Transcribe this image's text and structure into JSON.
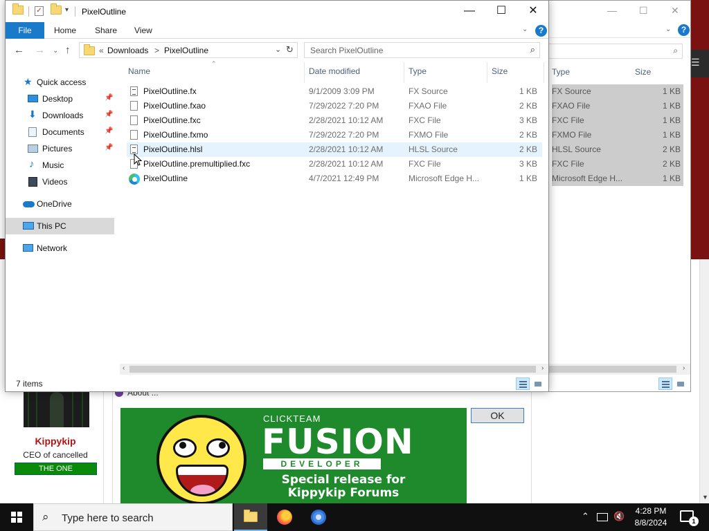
{
  "background_page": {
    "user_name": "Kippykip",
    "user_title": "CEO of cancelled",
    "user_badge": "THE ONE",
    "about_label": "About ...",
    "banner": {
      "line1": "CLICKTEAM",
      "line2": "FUSION",
      "line3": "DEVELOPER",
      "line4": "Special release for",
      "line5": "Kippykip Forums"
    },
    "ok_label": "OK"
  },
  "explorer_back": {
    "columns": {
      "type": "Type",
      "size": "Size"
    },
    "rows": [
      {
        "type": "FX Source",
        "size": "1 KB"
      },
      {
        "type": "FXAO File",
        "size": "1 KB"
      },
      {
        "type": "FXC File",
        "size": "1 KB"
      },
      {
        "type": "FXMO File",
        "size": "1 KB"
      },
      {
        "type": "HLSL Source",
        "size": "2 KB"
      },
      {
        "type": "FXC File",
        "size": "2 KB"
      },
      {
        "type": "Microsoft Edge H...",
        "size": "1 KB"
      }
    ]
  },
  "explorer": {
    "window_title": "PixelOutline",
    "ribbon_tabs": {
      "file": "File",
      "home": "Home",
      "share": "Share",
      "view": "View"
    },
    "address": {
      "overflow": "«",
      "segment1": "Downloads",
      "separator": ">",
      "segment2": "PixelOutline"
    },
    "search_placeholder": "Search PixelOutline",
    "nav": {
      "quick_access": "Quick access",
      "desktop": "Desktop",
      "downloads": "Downloads",
      "documents": "Documents",
      "pictures": "Pictures",
      "music": "Music",
      "videos": "Videos",
      "onedrive": "OneDrive",
      "this_pc": "This PC",
      "network": "Network"
    },
    "columns": {
      "name": "Name",
      "date": "Date modified",
      "type": "Type",
      "size": "Size"
    },
    "files": [
      {
        "name": "PixelOutline.fx",
        "date": "9/1/2009 3:09 PM",
        "type": "FX Source",
        "size": "1 KB",
        "icon": "text-file-icon"
      },
      {
        "name": "PixelOutline.fxao",
        "date": "7/29/2022 7:20 PM",
        "type": "FXAO File",
        "size": "2 KB",
        "icon": "file-icon"
      },
      {
        "name": "PixelOutline.fxc",
        "date": "2/28/2021 10:12 AM",
        "type": "FXC File",
        "size": "3 KB",
        "icon": "file-icon"
      },
      {
        "name": "PixelOutline.fxmo",
        "date": "7/29/2022 7:20 PM",
        "type": "FXMO File",
        "size": "2 KB",
        "icon": "file-icon"
      },
      {
        "name": "PixelOutline.hlsl",
        "date": "2/28/2021 10:12 AM",
        "type": "HLSL Source",
        "size": "2 KB",
        "icon": "text-file-icon"
      },
      {
        "name": "PixelOutline.premultiplied.fxc",
        "date": "2/28/2021 10:12 AM",
        "type": "FXC File",
        "size": "3 KB",
        "icon": "file-icon"
      },
      {
        "name": "PixelOutline",
        "date": "4/7/2021 12:49 PM",
        "type": "Microsoft Edge H...",
        "size": "1 KB",
        "icon": "edge-icon"
      }
    ],
    "status_count": "7 items"
  },
  "taskbar": {
    "search_placeholder": "Type here to search",
    "time": "4:28 PM",
    "date": "8/8/2024",
    "notification_count": "1"
  },
  "colors": {
    "accent": "#1979ca",
    "hover_row": "#e5f3ff",
    "selected_nav": "#d9d9d9",
    "taskbar": "#101010",
    "banner_green": "#1e8a2c",
    "forum_red": "#7a1212"
  }
}
